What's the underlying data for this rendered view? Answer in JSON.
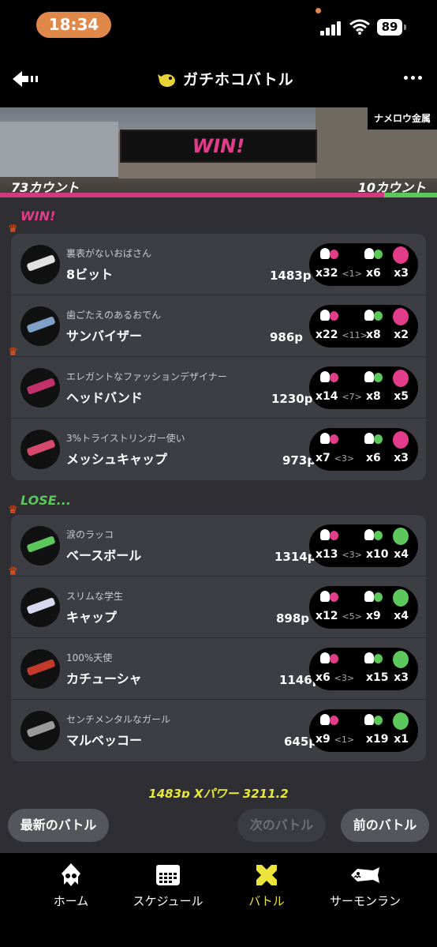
{
  "status_bar": {
    "time": "18:34",
    "battery": "89"
  },
  "header": {
    "title": "ガチホコバトル"
  },
  "banner": {
    "result": "WIN!",
    "stage": "ナメロウ金属",
    "ally_count": "73カウント",
    "enemy_count": "10カウント"
  },
  "win_label": "WIN!",
  "lose_label": "LOSE...",
  "win_team": [
    {
      "byname": "裏表がないおばさん",
      "name": "8ビット",
      "points": "1483p",
      "kills": "x32",
      "assists": "<1>",
      "specials_used": "x6",
      "special_count": "x3",
      "crown": true,
      "weapon_color": "#e1e1e1"
    },
    {
      "byname": "歯ごたえのあるおでん",
      "name": "サンバイザー",
      "points": "986p",
      "kills": "x22",
      "assists": "<11>",
      "specials_used": "x8",
      "special_count": "x2",
      "crown": false,
      "weapon_color": "#7fa0c8"
    },
    {
      "byname": "エレガントなファッションデザイナー",
      "name": "ヘッドバンド",
      "points": "1230p",
      "kills": "x14",
      "assists": "<7>",
      "specials_used": "x8",
      "special_count": "x5",
      "crown": true,
      "weapon_color": "#c0306a"
    },
    {
      "byname": "3%トライストリンガー使い",
      "name": "メッシュキャップ",
      "points": "973p",
      "kills": "x7",
      "assists": "<3>",
      "specials_used": "x6",
      "special_count": "x3",
      "crown": false,
      "weapon_color": "#d6486e"
    }
  ],
  "lose_team": [
    {
      "byname": "涙のラッコ",
      "name": "ベースボール",
      "points": "1314p",
      "kills": "x13",
      "assists": "<3>",
      "specials_used": "x10",
      "special_count": "x4",
      "crown": true,
      "weapon_color": "#5cc75a"
    },
    {
      "byname": "スリムな学生",
      "name": "キャップ",
      "points": "898p",
      "kills": "x12",
      "assists": "<5>",
      "specials_used": "x9",
      "special_count": "x4",
      "crown": true,
      "weapon_color": "#d8d8f0"
    },
    {
      "byname": "100%天使",
      "name": "カチューシャ",
      "points": "1146p",
      "kills": "x6",
      "assists": "<3>",
      "specials_used": "x15",
      "special_count": "x3",
      "crown": false,
      "weapon_color": "#c23a2a"
    },
    {
      "byname": "センチメンタルなガール",
      "name": "マルベッコー",
      "points": "645p",
      "kills": "x9",
      "assists": "<1>",
      "specials_used": "x19",
      "special_count": "x1",
      "crown": false,
      "weapon_color": "#9a9a9a"
    }
  ],
  "footer_stat": "1483p Xパワー 3211.2",
  "nav": {
    "latest": "最新のバトル",
    "next": "次のバトル",
    "prev": "前のバトル"
  },
  "tabs": [
    {
      "label": "ホーム",
      "icon": "squid-icon"
    },
    {
      "label": "スケジュール",
      "icon": "calendar-icon"
    },
    {
      "label": "バトル",
      "icon": "battle-icon"
    },
    {
      "label": "サーモンラン",
      "icon": "salmon-icon"
    }
  ],
  "colors": {
    "win": "#e23d8a",
    "lose": "#5cc75a",
    "accent": "#ebe43a"
  }
}
